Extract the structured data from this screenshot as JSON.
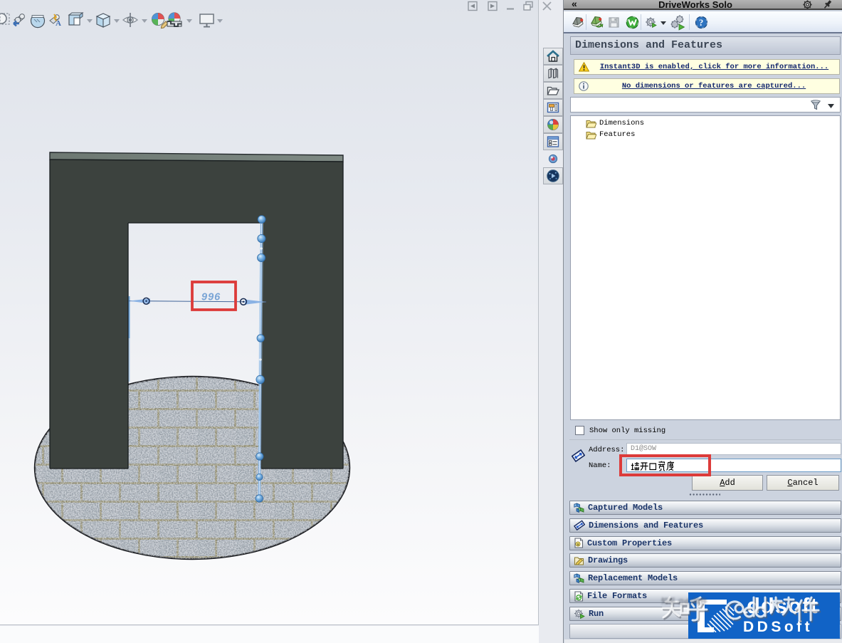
{
  "window": {
    "controls": [
      "previous-pane",
      "next-pane",
      "minimize",
      "restore",
      "close"
    ]
  },
  "heads_up_toolbar": {
    "icons": [
      "zoom-to-area",
      "previous-view",
      "section-view",
      "annotation-views",
      "view-orientation",
      "display-style",
      "hide-show-items",
      "edit-appearance",
      "apply-scene",
      "view-settings"
    ]
  },
  "viewport": {
    "dimension_value": "996",
    "highlights": [
      "dimension-value-red-box",
      "name-field-red-box"
    ]
  },
  "task_pane_tabs": [
    "solidworks-resources",
    "design-library",
    "file-explorer",
    "view-palette",
    "appearances-scenes",
    "custom-properties",
    "driveworksxpress",
    "driveworks-solo"
  ],
  "panel": {
    "title": "DriveWorks Solo",
    "collapse_glyph": "«",
    "toolbar_icons": [
      "new-project",
      "open-project",
      "save-project",
      "driveworks-home",
      "generate-models",
      "generate-all",
      "help"
    ],
    "section_header": "Dimensions and Features",
    "notices": [
      {
        "icon": "warning",
        "text": "Instant3D is enabled, click for more information..."
      },
      {
        "icon": "info",
        "text": "No dimensions or features are captured..."
      }
    ],
    "filter": {
      "icon": "funnel"
    },
    "tree": {
      "items": [
        {
          "label": "Dimensions"
        },
        {
          "label": "Features"
        }
      ]
    },
    "show_only_missing": {
      "label": "Show only missing",
      "checked": false
    },
    "capture_form": {
      "address_label": "Address:",
      "address_value": "D1@SOW",
      "name_label": "Name:",
      "name_value": "墙开口宽度",
      "add_label": "Add",
      "add_underline": "A",
      "add_rest": "dd",
      "cancel_label": "Cancel",
      "cancel_underline": "C",
      "cancel_rest": "ancel"
    },
    "sections": [
      {
        "label": "Captured Models",
        "icon": "cubes"
      },
      {
        "label": "Dimensions and Features",
        "icon": "dimension-arrow"
      },
      {
        "label": "Custom Properties",
        "icon": "property-page"
      },
      {
        "label": "Drawings",
        "icon": "drawing-sheet"
      },
      {
        "label": "Replacement Models",
        "icon": "cubes"
      },
      {
        "label": "File Formats",
        "icon": "file-formats"
      },
      {
        "label": "Run",
        "icon": "run-gear"
      }
    ]
  },
  "watermark": {
    "zhihu_text": "知乎 @dd软件",
    "zhihu_latin_part": "@dd",
    "logo_overlay_text": "ddsoft",
    "logo_text": "DDSoft"
  },
  "icon_glyphs": {
    "annotation": "A",
    "help": "?",
    "property": "s"
  },
  "colors": {
    "accent_blue": "#1163c6",
    "annotation_red": "#dc3b3a",
    "notice_bg": "#ffffe1",
    "link_blue": "#12266d",
    "sketch_blue": "#569ad9",
    "wall_gray": "#3f4742"
  }
}
